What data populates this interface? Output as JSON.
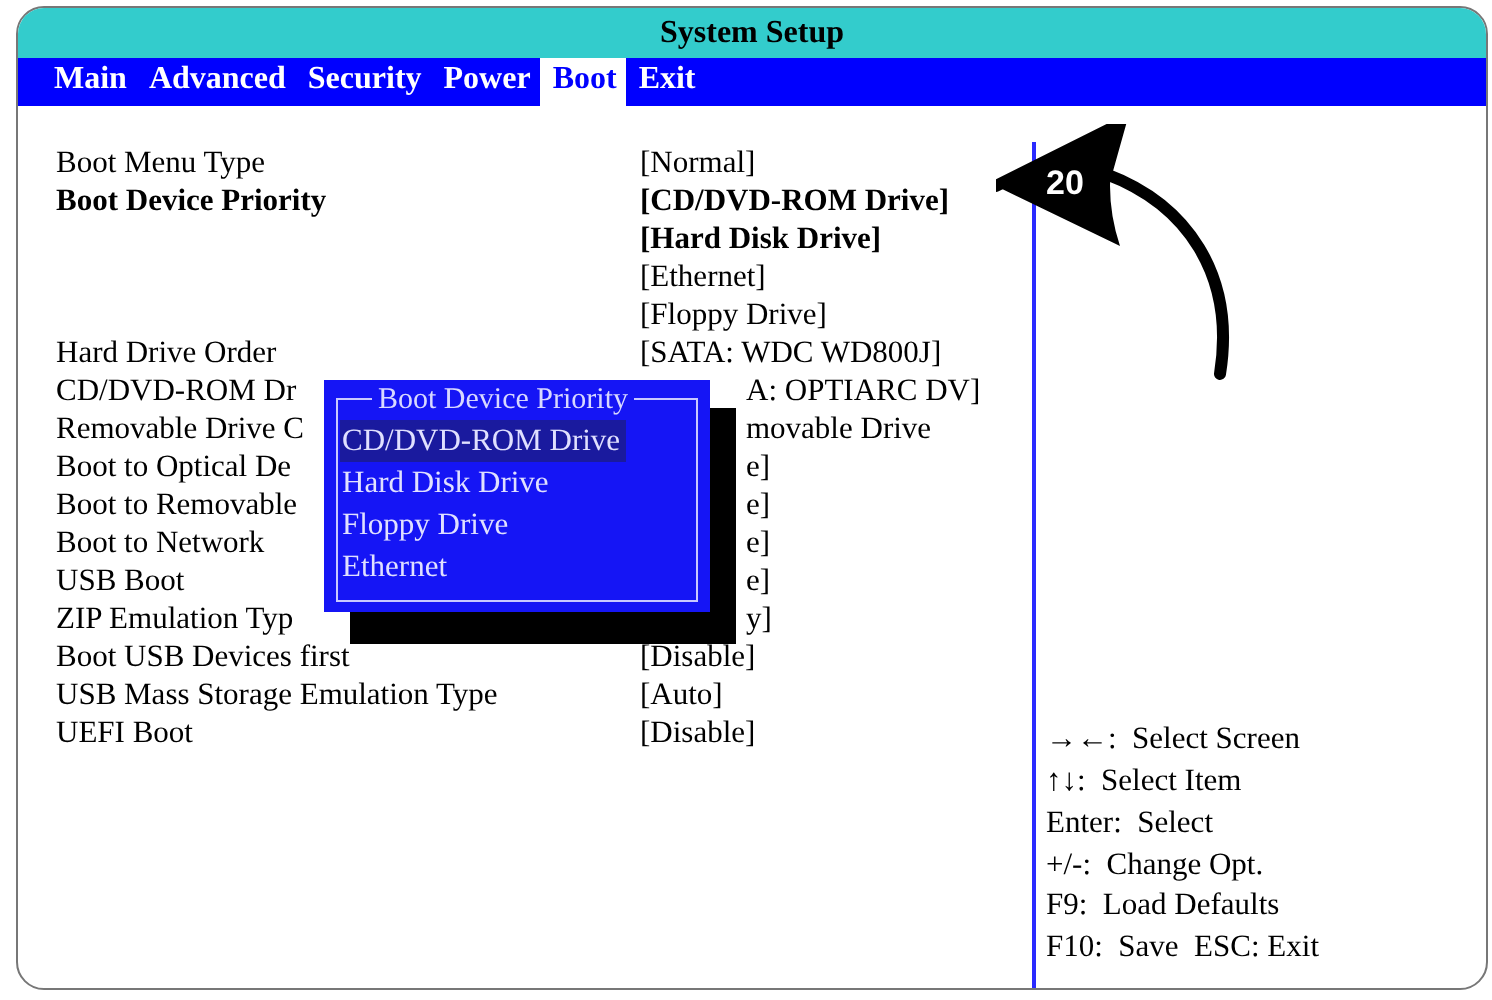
{
  "window": {
    "title": "System Setup"
  },
  "tabs": [
    {
      "label": "Main",
      "selected": false
    },
    {
      "label": "Advanced",
      "selected": false
    },
    {
      "label": "Security",
      "selected": false
    },
    {
      "label": "Power",
      "selected": false
    },
    {
      "label": "Boot",
      "selected": true
    },
    {
      "label": "Exit",
      "selected": false
    }
  ],
  "settings": [
    {
      "label": "Boot Menu Type",
      "bold": false,
      "covered": false,
      "values": [
        {
          "text": "[Normal]",
          "bold": false
        }
      ]
    },
    {
      "label": "Boot Device Priority",
      "bold": true,
      "covered": false,
      "values": [
        {
          "text": "[CD/DVD-ROM Drive]",
          "bold": true
        },
        {
          "text": "[Hard Disk Drive]",
          "bold": true
        },
        {
          "text": "[Ethernet]",
          "bold": false
        },
        {
          "text": "[Floppy Drive]",
          "bold": false
        }
      ]
    },
    {
      "label": "Hard Drive Order",
      "bold": false,
      "covered": false,
      "values": [
        {
          "text": "[SATA:  WDC WD800J]",
          "bold": false
        }
      ]
    },
    {
      "label": "CD/DVD-ROM Dr",
      "bold": false,
      "covered": true,
      "values": [
        {
          "text": "A:  OPTIARC DV]",
          "bold": false
        }
      ]
    },
    {
      "label": "Removable Drive C",
      "bold": false,
      "covered": true,
      "values": [
        {
          "text": "movable Drive",
          "bold": false
        }
      ]
    },
    {
      "label": "Boot to Optical De",
      "bold": false,
      "covered": true,
      "values": [
        {
          "text": "e]",
          "bold": false
        }
      ]
    },
    {
      "label": "Boot to Removable",
      "bold": false,
      "covered": true,
      "values": [
        {
          "text": "e]",
          "bold": false
        }
      ]
    },
    {
      "label": "Boot to Network",
      "bold": false,
      "covered": true,
      "values": [
        {
          "text": "e]",
          "bold": false
        }
      ]
    },
    {
      "label": "USB Boot",
      "bold": false,
      "covered": true,
      "values": [
        {
          "text": "e]",
          "bold": false
        }
      ]
    },
    {
      "label": "ZIP Emulation Typ",
      "bold": false,
      "covered": true,
      "values": [
        {
          "text": "y]",
          "bold": false
        }
      ]
    },
    {
      "label": "Boot USB Devices first",
      "bold": false,
      "covered": false,
      "values": [
        {
          "text": "[Disable]",
          "bold": false
        }
      ]
    },
    {
      "label": "USB Mass Storage Emulation Type",
      "bold": false,
      "covered": false,
      "values": [
        {
          "text": "[Auto]",
          "bold": false
        }
      ]
    },
    {
      "label": "UEFI Boot",
      "bold": false,
      "covered": false,
      "values": [
        {
          "text": "[Disable]",
          "bold": false
        }
      ]
    }
  ],
  "popup": {
    "title": "Boot Device Priority",
    "items": [
      {
        "label": "CD/DVD-ROM Drive",
        "selected": true
      },
      {
        "label": "Hard Disk Drive",
        "selected": false
      },
      {
        "label": "Floppy Drive",
        "selected": false
      },
      {
        "label": "Ethernet",
        "selected": false
      }
    ]
  },
  "callout": {
    "label": "20"
  },
  "help": [
    "→←:  Select Screen",
    "↑↓:  Select Item",
    "Enter:  Select",
    "+/-:  Change Opt.",
    "F9:  Load Defaults",
    "F10:  Save  ESC: Exit"
  ]
}
